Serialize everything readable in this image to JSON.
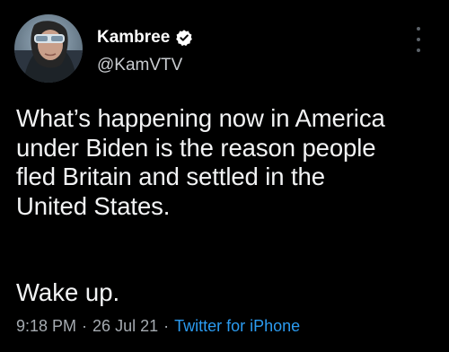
{
  "user": {
    "display_name": "Kambree",
    "handle": "@KamVTV",
    "verified": true,
    "avatar_icon": "profile-photo"
  },
  "tweet": {
    "text": "What’s happening now in America\nunder Biden is the reason people\nfled Britain and settled in the\nUnited States.",
    "closing_line": "Wake up.",
    "time": "9:18 PM",
    "date": "26 Jul 21",
    "separator": "·",
    "source": "Twitter for iPhone"
  },
  "colors": {
    "background": "#000000",
    "text": "#f2f3f4",
    "secondary_text": "#a5abb1",
    "link": "#2b9bf0",
    "verified_badge": "#ffffff"
  },
  "icons": {
    "verified": "verified-badge-icon",
    "more": "more-vertical-icon"
  }
}
